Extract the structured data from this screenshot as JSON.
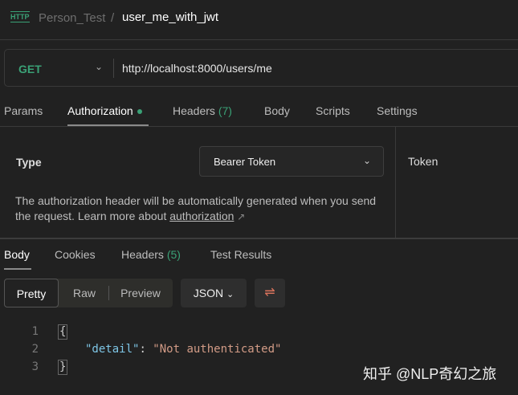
{
  "header": {
    "icon_label": "HTTP",
    "collection": "Person_Test",
    "separator": "/",
    "request_name": "user_me_with_jwt"
  },
  "request": {
    "method": "GET",
    "url": "http://localhost:8000/users/me"
  },
  "request_tabs": [
    {
      "label": "Params"
    },
    {
      "label": "Authorization"
    },
    {
      "label": "Headers",
      "count": "(7)"
    },
    {
      "label": "Body"
    },
    {
      "label": "Scripts"
    },
    {
      "label": "Settings"
    }
  ],
  "auth": {
    "type_label": "Type",
    "type_value": "Bearer Token",
    "description": "The authorization header will be automatically generated when you send the request. Learn more about ",
    "link": "authorization",
    "link_icon": "↗",
    "token_label": "Token"
  },
  "response_tabs": [
    {
      "label": "Body"
    },
    {
      "label": "Cookies"
    },
    {
      "label": "Headers",
      "count": "(5)"
    },
    {
      "label": "Test Results"
    }
  ],
  "view_modes": [
    "Pretty",
    "Raw",
    "Preview"
  ],
  "format": "JSON",
  "code": {
    "line_numbers": [
      "1",
      "2",
      "3"
    ],
    "open": "{",
    "key": "\"detail\"",
    "colon": ": ",
    "value": "\"Not authenticated\"",
    "close": "}"
  },
  "watermark": "知乎 @NLP奇幻之旅"
}
